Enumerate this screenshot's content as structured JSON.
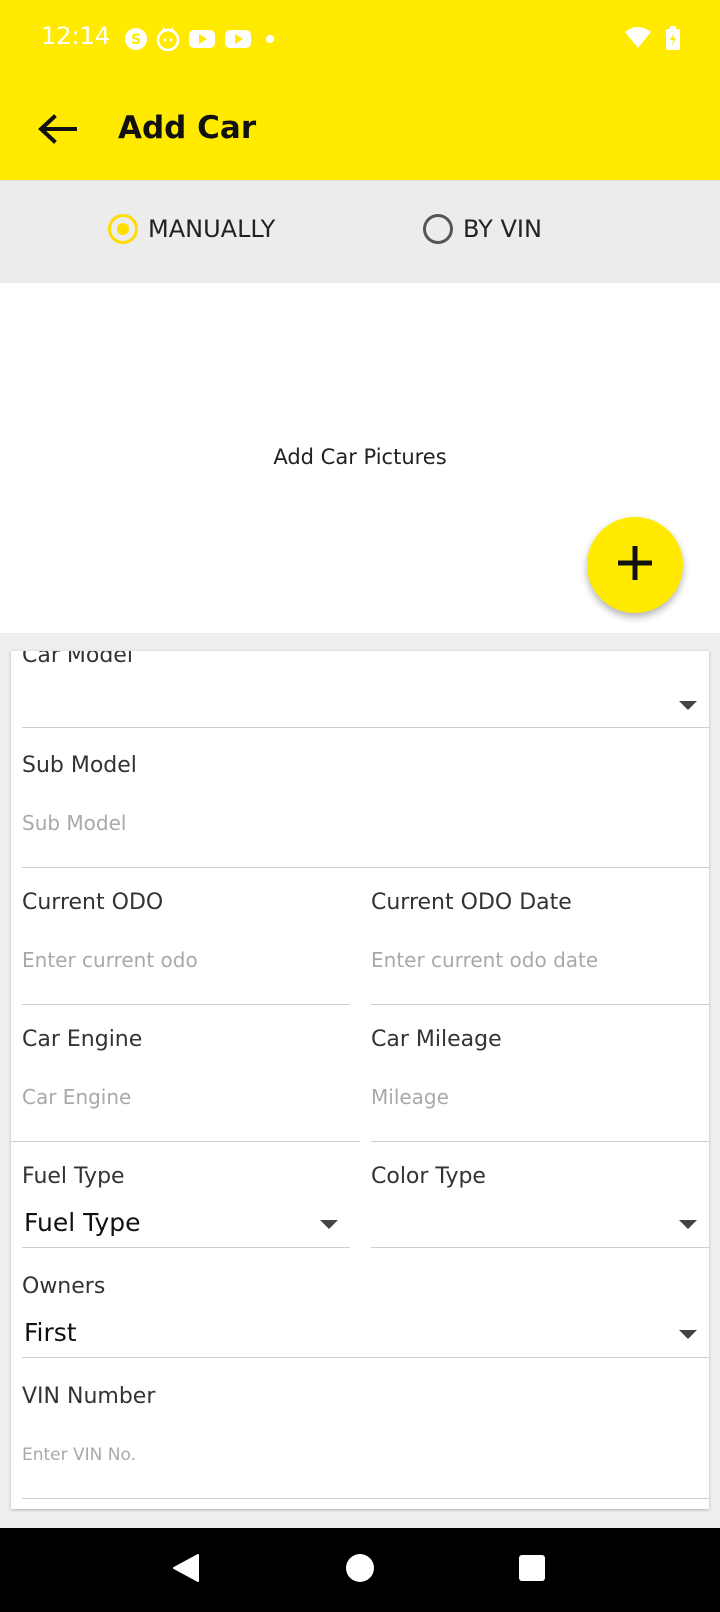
{
  "status_bar": {
    "time": "12:14",
    "notification_icons": [
      "skype-icon",
      "cat-app-icon",
      "youtube-icon",
      "youtube-icon"
    ],
    "system_icons": [
      "wifi-icon",
      "battery-charging-icon"
    ]
  },
  "app_bar": {
    "title": "Add Car",
    "back_icon": "arrow-left-icon",
    "background": "#ffea00"
  },
  "mode": {
    "options": [
      {
        "label": "MANUALLY",
        "selected": true
      },
      {
        "label": "BY VIN",
        "selected": false
      }
    ],
    "accent": "#ffdd00"
  },
  "pictures": {
    "label": "Add Car Pictures",
    "fab_icon": "plus-icon"
  },
  "form": {
    "car_model": {
      "label": "Car Model",
      "value": ""
    },
    "sub_model": {
      "label": "Sub Model",
      "placeholder": "Sub Model"
    },
    "current_odo": {
      "label": "Current ODO",
      "placeholder": "Enter current odo"
    },
    "current_odo_date": {
      "label": "Current ODO Date",
      "placeholder": "Enter current odo date"
    },
    "car_engine": {
      "label": "Car Engine",
      "placeholder": "Car Engine"
    },
    "car_mileage": {
      "label": "Car Mileage",
      "placeholder": "Mileage"
    },
    "fuel_type": {
      "label": "Fuel Type",
      "value": "Fuel Type"
    },
    "color_type": {
      "label": "Color Type",
      "value": ""
    },
    "owners": {
      "label": "Owners",
      "value": "First"
    },
    "vin_number": {
      "label": "VIN Number",
      "placeholder": "Enter VIN No."
    }
  },
  "nav_bar": {
    "buttons": [
      "back-triangle-icon",
      "home-circle-icon",
      "recents-square-icon"
    ]
  }
}
